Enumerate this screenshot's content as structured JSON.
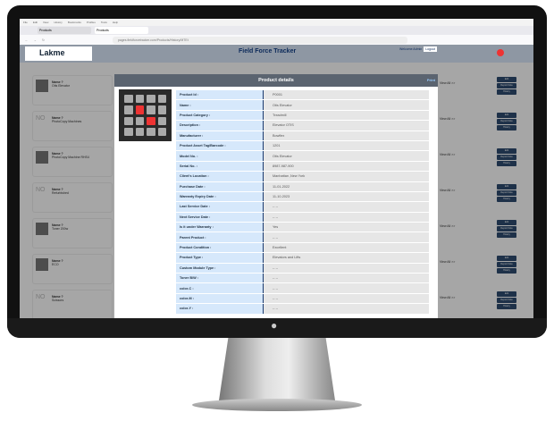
{
  "browser": {
    "menu": [
      "File",
      "Edit",
      "View",
      "History",
      "Bookmarks",
      "Profiles",
      "Tools",
      "Help"
    ],
    "tabs": [
      "Products",
      "Products"
    ],
    "url": "pages.fieldforcetracker.com/Products/History/MTEt"
  },
  "header": {
    "logo": "Lakme",
    "title": "Field Force Tracker",
    "welcome": "Welcome Admin",
    "logout": "Logout"
  },
  "list": [
    {
      "label": "Name ?",
      "name": "Otis Elevator",
      "thumb": "img"
    },
    {
      "label": "Name ?",
      "name": "PhotoCopy Machines",
      "thumb": "NO"
    },
    {
      "label": "Name ?",
      "name": "PhotoCopy Machine RHS4",
      "thumb": "img"
    },
    {
      "label": "Name ?",
      "name": "Refurbished",
      "thumb": "NO"
    },
    {
      "label": "Name ?",
      "name": "Toner 200w",
      "thumb": "img"
    },
    {
      "label": "Name ?",
      "name": "ECO",
      "thumb": "img"
    },
    {
      "label": "Name ?",
      "name": "Scissors",
      "thumb": "NO"
    }
  ],
  "row_actions": {
    "view_all": "View All >>",
    "edit": "Edit",
    "report": "Report Note",
    "history": "History"
  },
  "modal": {
    "title": "Product details",
    "print": "Print",
    "rows": [
      [
        "Product Id :",
        "P0001"
      ],
      [
        "Name :",
        "Otis Elevator"
      ],
      [
        "Product Category :",
        "Treadmill"
      ],
      [
        "Description :",
        "Elevator OTIS"
      ],
      [
        "Manufacturer :",
        "Bowflex"
      ],
      [
        "Product Asset Tag/Barcode :",
        "1201"
      ],
      [
        "Model No. :",
        "Otis Elevator"
      ],
      [
        "Serial No. :",
        "8987-987-900"
      ],
      [
        "Client's Location :",
        "Manhattan ,New York"
      ],
      [
        "Purchase Date :",
        "11-01-2022"
      ],
      [
        "Warranty Expiry Date :",
        "11-10-2023"
      ],
      [
        "Last Service Date :",
        "-- --"
      ],
      [
        "Next Service Date :",
        "-- --"
      ],
      [
        "Is it under Warranty :",
        "Yes"
      ],
      [
        "Parent Product :",
        "-- --"
      ],
      [
        "Product Condition :",
        "Excellent"
      ],
      [
        "Product Type :",
        "Elevators and Lifts"
      ],
      [
        "Custom Module Type :",
        "-- --"
      ],
      [
        "Toner B/W :",
        "-- --"
      ],
      [
        "color-C :",
        "-- --"
      ],
      [
        "color-M :",
        "-- --"
      ],
      [
        "color-Y :",
        "-- --"
      ]
    ]
  }
}
